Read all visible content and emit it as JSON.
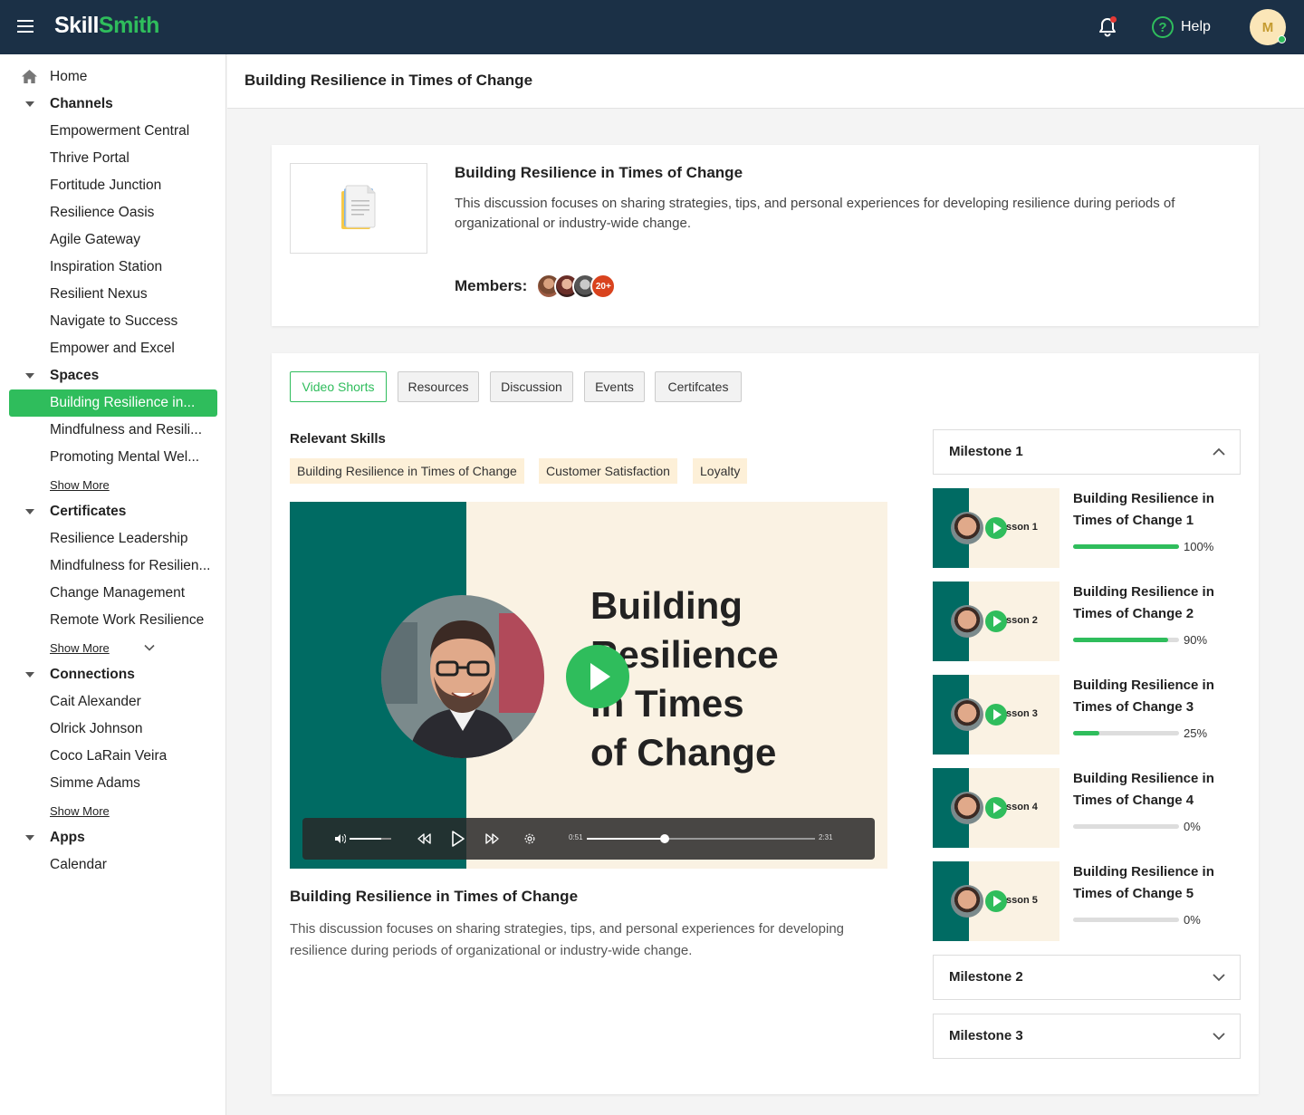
{
  "app": {
    "logo_part1": "Skill",
    "logo_part2": "Smith",
    "help_label": "Help",
    "user_initial": "M"
  },
  "sidebar": {
    "home": "Home",
    "channels_title": "Channels",
    "channels": [
      "Empowerment Central",
      "Thrive Portal",
      "Fortitude Junction",
      "Resilience Oasis",
      "Agile Gateway",
      "Inspiration Station",
      "Resilient Nexus",
      "Navigate to Success",
      "Empower and Excel"
    ],
    "spaces_title": "Spaces",
    "spaces": [
      "Building Resilience in...",
      "Mindfulness and Resili...",
      "Promoting Mental Wel..."
    ],
    "spaces_more": "Show More",
    "certificates_title": "Certificates",
    "certificates": [
      "Resilience Leadership",
      "Mindfulness for Resilien...",
      "Change Management",
      "Remote Work Resilience"
    ],
    "certificates_more": "Show More",
    "connections_title": "Connections",
    "connections": [
      "Cait Alexander",
      "Olrick Johnson",
      "Coco LaRain Veira",
      "Simme Adams"
    ],
    "connections_more": "Show More",
    "apps_title": "Apps",
    "apps": [
      "Calendar"
    ]
  },
  "header": {
    "title": "Building Resilience in Times of Change"
  },
  "info": {
    "title": "Building Resilience in Times of Change",
    "description": "This discussion focuses on sharing strategies, tips, and personal experiences for developing resilience during periods of organizational or industry-wide change.",
    "members_label": "Members:",
    "members_count": "20+"
  },
  "tabs": [
    "Video Shorts",
    "Resources",
    "Discussion",
    "Events",
    "Certifcates"
  ],
  "skills": {
    "title": "Relevant Skills",
    "chips": [
      "Building Resilience in Times of Change",
      "Customer Satisfaction",
      "Loyalty"
    ]
  },
  "video": {
    "overlay_title_lines": [
      "Building",
      "Resilience",
      "in Times",
      "of Change"
    ],
    "current_time": "0:51",
    "duration": "2:31",
    "progress": 0.34,
    "volume": 0.75,
    "title": "Building Resilience in Times of Change",
    "description": "This discussion focuses on sharing strategies, tips, and personal experiences for developing resilience during periods of organizational or industry-wide change."
  },
  "milestones": [
    {
      "title": "Milestone 1",
      "expanded": true,
      "lessons": [
        {
          "thumb_label": "sson 1",
          "title": "Building Resilience in Times of Change 1",
          "progress": 100,
          "progress_label": "100%"
        },
        {
          "thumb_label": "sson 2",
          "title": "Building Resilience in Times of Change 2",
          "progress": 90,
          "progress_label": "90%"
        },
        {
          "thumb_label": "sson 3",
          "title": "Building Resilience in Times of Change 3",
          "progress": 25,
          "progress_label": "25%"
        },
        {
          "thumb_label": "sson 4",
          "title": "Building Resilience in Times of Change 4",
          "progress": 0,
          "progress_label": "0%"
        },
        {
          "thumb_label": "sson 5",
          "title": "Building Resilience in Times of Change 5",
          "progress": 0,
          "progress_label": "0%"
        }
      ]
    },
    {
      "title": "Milestone 2",
      "expanded": false
    },
    {
      "title": "Milestone 3",
      "expanded": false
    }
  ],
  "colors": {
    "brand_green": "#2fbd5c",
    "topbar": "#1b3046",
    "teal": "#006b63",
    "cream": "#faf2e3",
    "chip": "#fdf0d8",
    "members_badge": "#d9431e"
  }
}
